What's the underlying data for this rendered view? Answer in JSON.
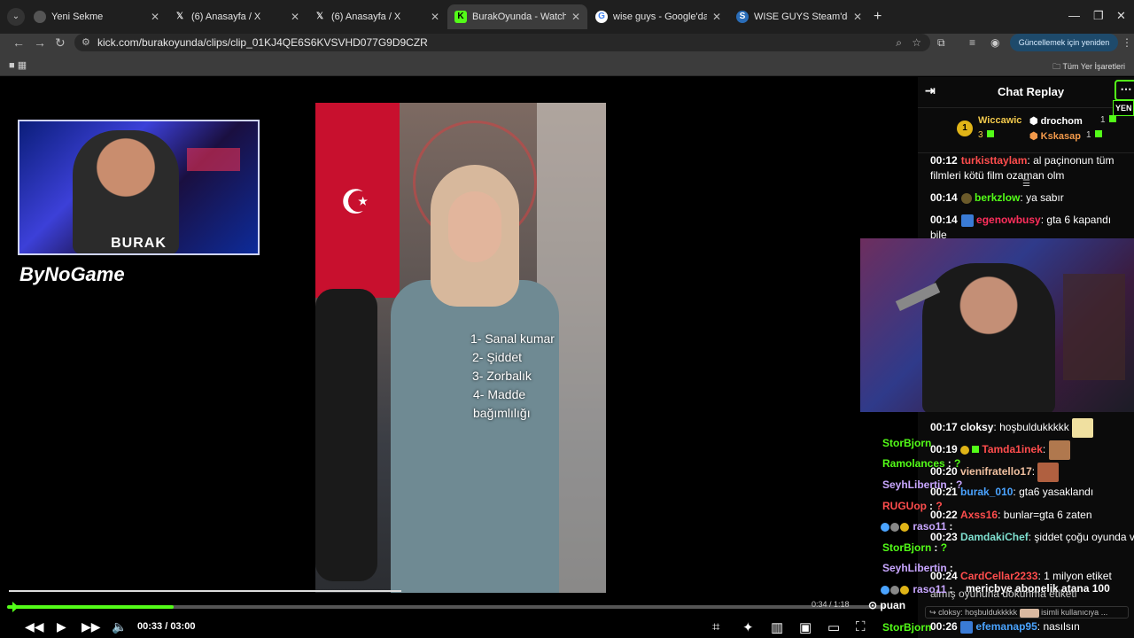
{
  "browser": {
    "tabs": [
      {
        "title": "Yeni Sekme",
        "icon": "chrome-icon",
        "color": "#9aa0a6",
        "active": false
      },
      {
        "title": "(6) Anasayfa / X",
        "icon": "x-icon",
        "color": "#000000",
        "active": false
      },
      {
        "title": "(6) Anasayfa / X",
        "icon": "x-icon",
        "color": "#000000",
        "active": false
      },
      {
        "title": "BurakOyunda - Watch clips on",
        "icon": "kick-icon",
        "color": "#53fc18",
        "active": true
      },
      {
        "title": "wise guys - Google'da Ara",
        "icon": "google-icon",
        "color": "#4285f4",
        "active": false
      },
      {
        "title": "WISE GUYS Steam'de",
        "icon": "steam-icon",
        "color": "#1b2838",
        "active": false
      }
    ],
    "url": "kick.com/burakoyunda/clips/clip_01KJ4QE6S6KVSVHD077G9D9CZR",
    "update_button": "Güncellemek için yeniden başlat",
    "bookmarks_label": "Tüm Yer İşaretleri"
  },
  "video": {
    "cam_name": "BURAK",
    "cam_logo": "ByNoGame",
    "caption": [
      "1- Sanal kumar",
      "2- Şiddet",
      "3- Zorbalık",
      "4- Madde",
      "bağımlılığı"
    ],
    "clip_time": "0:34 / 1:18",
    "puan_label": "puan",
    "current_time": "00:33",
    "duration": "03:00",
    "progress": 0.19
  },
  "chat": {
    "title": "Chat Replay",
    "new_badge": "YEN",
    "leaderboard": {
      "first": {
        "rank": "1",
        "name": "Wiccawic",
        "count": "3"
      },
      "second": {
        "name": "drochom",
        "count": "1"
      },
      "third": {
        "name": "Kskasap",
        "count": "1"
      }
    },
    "messages": [
      {
        "time": "00:12",
        "user": "turkisttaylam",
        "user_color": "#ff4d4d",
        "text": "al paçinonun tüm filmleri kötü film ozaman olm"
      },
      {
        "time": "00:14",
        "user": "berkzlow",
        "user_color": "#53fc18",
        "text": "ya sabır"
      },
      {
        "time": "00:14",
        "user": "egenowbusy",
        "user_color": "#ff2f5c",
        "text": "gta 6 kapandı bile"
      }
    ],
    "lower_messages": [
      {
        "time": "00:17",
        "user": "cloksy",
        "user_color": "#ffffff",
        "text": "hoşbuldukkkkk"
      },
      {
        "time": "00:19",
        "user": "Tamda1inek",
        "user_color": "#ff4d4d",
        "text": ""
      },
      {
        "time": "00:20",
        "user": "vienifratello17",
        "user_color": "#f0c0a0",
        "text": ""
      },
      {
        "time": "00:21",
        "user": "burak_010",
        "user_color": "#4aa3ff",
        "text": "gta6 yasaklandı"
      },
      {
        "time": "00:22",
        "user": "Axss16",
        "user_color": "#ff4d4d",
        "text": "bunlar=gta 6 zaten"
      },
      {
        "time": "00:23",
        "user": "DamdakiChef",
        "user_color": "#7fe0d0",
        "text": "şiddet çoğu oyunda var"
      },
      {
        "time": "00:24",
        "user": "CardCellar2233",
        "user_color": "#ff4d4d",
        "text": "1 milyon etiket"
      },
      {
        "time": "00:26",
        "user": "efemanap95",
        "user_color": "#4aa3ff",
        "text": "nasılsın"
      }
    ],
    "overlay_line": "mericbye abonelik atana 100",
    "overlay_sub": "almış oyununa dokunma etiketi",
    "pinned": {
      "user": "cloksy",
      "text": "hoşbuldukkkkk",
      "suffix": "isimli kullanıcıya ..."
    }
  },
  "overlay_chat": [
    {
      "user": "StorBjorn",
      "color": "#53fc18",
      "text": ""
    },
    {
      "user": "Ramolances",
      "color": "#53fc18",
      "text": "?"
    },
    {
      "user": "SeyhLibertin",
      "color": "#c8a6ff",
      "text": "?"
    },
    {
      "user": "RUGUop",
      "color": "#ff4d4d",
      "text": "?"
    },
    {
      "user": "raso11",
      "color": "#c8a6ff",
      "text": ""
    },
    {
      "user": "StorBjorn",
      "color": "#53fc18",
      "text": "?"
    },
    {
      "user": "SeyhLibertin",
      "color": "#c8a6ff",
      "text": ""
    },
    {
      "user": "raso11",
      "color": "#c8a6ff",
      "text": ""
    },
    {
      "user": "StorBjorn",
      "color": "#53fc18",
      "text": ""
    }
  ]
}
